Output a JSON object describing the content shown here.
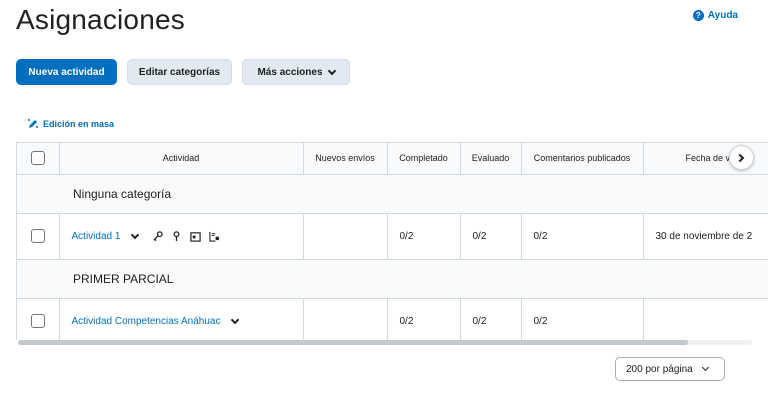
{
  "header": {
    "title": "Asignaciones",
    "help_label": "Ayuda",
    "help_glyph": "?"
  },
  "toolbar": {
    "new_activity": "Nueva actividad",
    "edit_categories": "Editar categorías",
    "more_actions": "Más acciones"
  },
  "bulk_edit": {
    "label": "Edición en masa",
    "icon": "bulk-edit-icon"
  },
  "table": {
    "columns": [
      "Actividad",
      "Nuevos envíos",
      "Completado",
      "Evaluado",
      "Comentarios publicados",
      "Fecha de ve"
    ],
    "categories": [
      {
        "name": "Ninguna categoría",
        "items": [
          {
            "activity": "Actividad 1",
            "new_submissions": "",
            "completed": "0/2",
            "evaluated": "0/2",
            "feedback_published": "0/2",
            "due_date": "30 de noviembre de 2"
          }
        ]
      },
      {
        "name": "PRIMER PARCIAL",
        "items": [
          {
            "activity": "Actividad Competencias Anáhuac",
            "new_submissions": "",
            "completed": "0/2",
            "evaluated": "0/2",
            "feedback_published": "0/2",
            "due_date": ""
          }
        ]
      }
    ]
  },
  "pagination": {
    "per_page": "200 por página"
  },
  "colors": {
    "accent": "#006fbf",
    "header_bg": "#f9fafb",
    "border": "#d3d9e3"
  }
}
